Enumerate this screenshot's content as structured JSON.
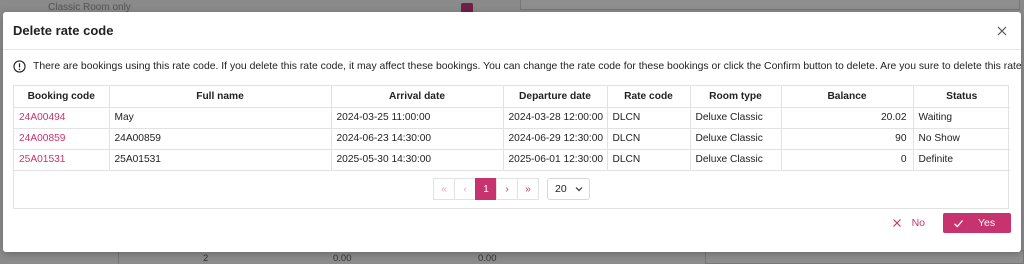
{
  "background": {
    "faint_text": "Classic Room only",
    "bottom_cells": [
      "2",
      "0.00",
      "0.00"
    ]
  },
  "modal": {
    "title": "Delete rate code",
    "warning": "There are bookings using this rate code. If you delete this rate code, it may affect these bookings. You can change the rate code for these bookings or click the Confirm button to delete. Are you sure to delete this rate code?",
    "columns": [
      "Booking code",
      "Full name",
      "Arrival date",
      "Departure date",
      "Rate code",
      "Room type",
      "Balance",
      "Status"
    ],
    "rows": [
      {
        "booking_code": "24A00494",
        "full_name": "May",
        "arrival": "2024-03-25 11:00:00",
        "departure": "2024-03-28 12:00:00",
        "rate_code": "DLCN",
        "room_type": "Deluxe Classic",
        "balance": "20.02",
        "status": "Waiting"
      },
      {
        "booking_code": "24A00859",
        "full_name": "24A00859",
        "arrival": "2024-06-23 14:30:00",
        "departure": "2024-06-29 12:30:00",
        "rate_code": "DLCN",
        "room_type": "Deluxe Classic",
        "balance": "90",
        "status": "No Show"
      },
      {
        "booking_code": "25A01531",
        "full_name": "25A01531",
        "arrival": "2025-05-30 14:30:00",
        "departure": "2025-06-01 12:30:00",
        "rate_code": "DLCN",
        "room_type": "Deluxe Classic",
        "balance": "0",
        "status": "Definite"
      }
    ],
    "pagination": {
      "first": "«",
      "prev": "‹",
      "current_page": "1",
      "next": "›",
      "last": "»",
      "page_size": "20"
    },
    "buttons": {
      "no": "No",
      "yes": "Yes"
    },
    "accent_color": "#c7336f"
  }
}
